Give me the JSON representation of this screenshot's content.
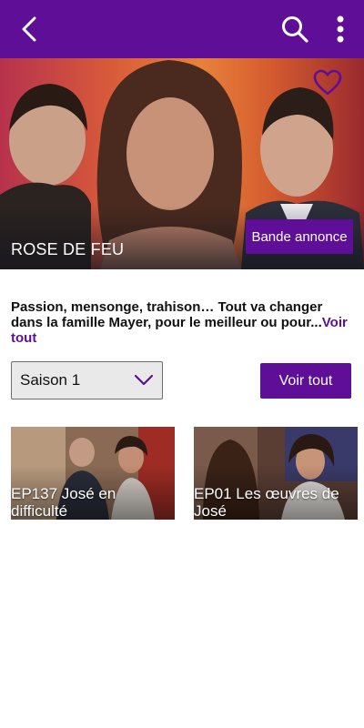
{
  "colors": {
    "accent": "#5f0e97",
    "page_bg": "#ffffff"
  },
  "appbar": {
    "back_icon": "chevron-left-icon",
    "search_icon": "search-icon",
    "more_icon": "more-vertical-icon"
  },
  "hero": {
    "title": "ROSE DE FEU",
    "favorite_icon": "heart-outline-icon",
    "trailer_label": "Bande annonce"
  },
  "description": {
    "text": "Passion, mensonge, trahison… Tout va changer dans la famille Mayer, pour le meilleur ou pour...",
    "more_link": "Voir tout"
  },
  "season_select": {
    "selected": "Saison 1",
    "icon": "chevron-down-icon"
  },
  "voir_tout_button": "Voir tout",
  "episodes": [
    {
      "title": "EP137 José en difficulté"
    },
    {
      "title": "EP01 Les œuvres de José"
    }
  ]
}
